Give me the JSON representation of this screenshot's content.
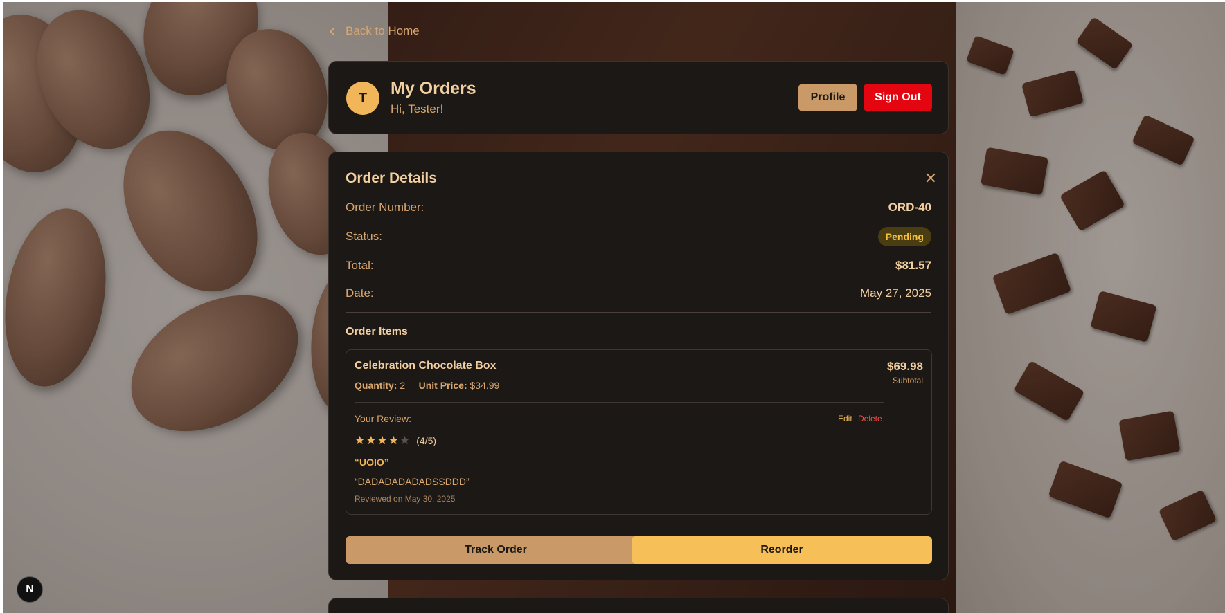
{
  "nav": {
    "back_label": "Back to Home"
  },
  "header": {
    "avatar_initial": "T",
    "title": "My Orders",
    "greeting": "Hi, Tester!",
    "profile_label": "Profile",
    "signout_label": "Sign Out"
  },
  "order": {
    "heading": "Order Details",
    "number_label": "Order Number:",
    "number_value": "ORD-40",
    "status_label": "Status:",
    "status_value": "Pending",
    "total_label": "Total:",
    "total_value": "$81.57",
    "date_label": "Date:",
    "date_value": "May 27, 2025",
    "items_heading": "Order Items",
    "items": [
      {
        "name": "Celebration Chocolate Box",
        "quantity_label": "Quantity:",
        "quantity": "2",
        "unit_price_label": "Unit Price:",
        "unit_price": "$34.99",
        "subtotal": "$69.98",
        "subtotal_label": "Subtotal",
        "review": {
          "label": "Your Review:",
          "edit_label": "Edit",
          "delete_label": "Delete",
          "rating": 4,
          "rating_max": 5,
          "rating_text": "(4/5)",
          "title": "“UOIO”",
          "body": "“DADADADADADSSDDD”",
          "date": "Reviewed on May 30, 2025"
        }
      }
    ],
    "track_label": "Track Order",
    "reorder_label": "Reorder"
  },
  "dev_badge": {
    "letter": "N"
  },
  "colors": {
    "accent_gold": "#f6bf58",
    "accent_tan": "#c99a67",
    "danger": "#e3050f",
    "card_bg": "#1c1815",
    "status_pending": "#f6c13b"
  }
}
